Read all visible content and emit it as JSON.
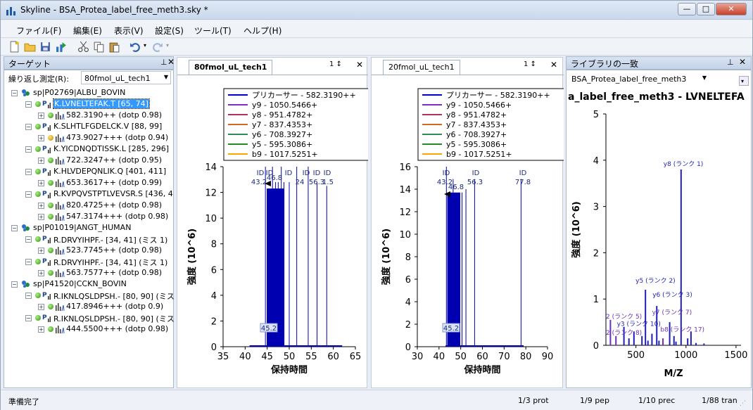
{
  "window": {
    "title": "Skyline - BSA_Protea_label_free_meth3.sky *"
  },
  "menu": [
    "ファイル(F)",
    "編集(E)",
    "表示(V)",
    "設定(S)",
    "ツール(T)",
    "ヘルプ(H)"
  ],
  "targets": {
    "title": "ターゲット",
    "replicate_label": "繰り返し測定(R):",
    "replicate_value": "80fmol_uL_tech1",
    "rows": [
      {
        "level": 0,
        "text": "sp|P02769|ALBU_BOVIN",
        "icon": "protein"
      },
      {
        "level": 1,
        "text": "K.LVNELTEFAK.T [65, 74]",
        "icon": "peptide",
        "selected": true
      },
      {
        "level": 2,
        "text": "582.3190++ (dotp 0.98)",
        "icon": "precursor",
        "dot": "g"
      },
      {
        "level": 1,
        "text": "K.SLHTLFGDELCK.V [88, 99]",
        "icon": "peptide"
      },
      {
        "level": 2,
        "text": "473.9027+++ (dotp 0.94)",
        "icon": "precursor",
        "dot": "y"
      },
      {
        "level": 1,
        "text": "K.YICDNQDTISSK.L [285, 296]",
        "icon": "peptide"
      },
      {
        "level": 2,
        "text": "722.3247++ (dotp 0.95)",
        "icon": "precursor",
        "dot": "g"
      },
      {
        "level": 1,
        "text": "K.HLVDEPQNLIK.Q [401, 411]",
        "icon": "peptide"
      },
      {
        "level": 2,
        "text": "653.3617++ (dotp 0.99)",
        "icon": "precursor",
        "dot": "g"
      },
      {
        "level": 1,
        "text": "R.KVPQVSTPTLVEVSR.S [436, 4",
        "icon": "peptide"
      },
      {
        "level": 2,
        "text": "820.4725++ (dotp 0.98)",
        "icon": "precursor",
        "dot": "g"
      },
      {
        "level": 2,
        "text": "547.3174+++ (dotp 0.98)",
        "icon": "precursor",
        "dot": "g"
      },
      {
        "level": 0,
        "text": "sp|P01019|ANGT_HUMAN",
        "icon": "protein"
      },
      {
        "level": 1,
        "text": "R.DRVYIHPF.- [34, 41] (ミス 1)",
        "icon": "peptide"
      },
      {
        "level": 2,
        "text": "523.7745++ (dotp 0.98)",
        "icon": "precursor",
        "dot": "g"
      },
      {
        "level": 1,
        "text": "R.DRVYIHPF.- [34, 41] (ミス 1)",
        "icon": "peptide"
      },
      {
        "level": 2,
        "text": "563.7577++ (dotp 0.98)",
        "icon": "precursor",
        "dot": "g"
      },
      {
        "level": 0,
        "text": "sp|P41520|CCKN_BOVIN",
        "icon": "protein"
      },
      {
        "level": 1,
        "text": "R.IKNLQSLDPSH.- [80, 90] (ミス",
        "icon": "peptide"
      },
      {
        "level": 2,
        "text": "417.8946+++ (dotp 0.9)",
        "icon": "precursor",
        "dot": "g"
      },
      {
        "level": 1,
        "text": "R.IKNLQSLDPSH.- [80, 90] (ミス",
        "icon": "peptide"
      },
      {
        "level": 2,
        "text": "444.5500+++ (dotp 0.98)",
        "icon": "precursor",
        "dot": "g"
      }
    ]
  },
  "legend": [
    {
      "label": "プリカーサー - 582.3190++",
      "color": "#0000cc"
    },
    {
      "label": "y9 - 1050.5466+",
      "color": "#7b2fbe"
    },
    {
      "label": "y8 - 951.4782+",
      "color": "#b03060"
    },
    {
      "label": "y7 - 837.4353+",
      "color": "#d2691e"
    },
    {
      "label": "y6 - 708.3927+",
      "color": "#2e8b57"
    },
    {
      "label": "y5 - 595.3086+",
      "color": "#228b22"
    },
    {
      "label": "b9 - 1017.5251+",
      "color": "#ffa500"
    }
  ],
  "chrom1": {
    "tab": "80fmol_uL_tech1",
    "xlabel": "保持時間",
    "ylabel": "強度 (10^6)",
    "xticks": [
      "35",
      "40",
      "45",
      "50",
      "55",
      "60",
      "65"
    ],
    "yticks": [
      "0",
      "2",
      "4",
      "6",
      "8",
      "10",
      "12",
      "14"
    ],
    "peak_labels": {
      "id": "ID",
      "a": "43.2",
      "b": "46.8",
      "c": "24",
      "d": "56.3",
      "e": "1.5",
      "f": "45.2"
    }
  },
  "chrom2": {
    "tab": "20fmol_uL_tech1",
    "xlabel": "保持時間",
    "ylabel": "強度 (10^6)",
    "xticks": [
      "30",
      "40",
      "50",
      "60",
      "70",
      "80",
      "90"
    ],
    "yticks": [
      "0",
      "2",
      "4",
      "6",
      "8",
      "10",
      "12",
      "14",
      "16"
    ],
    "peak_labels": {
      "id": "ID",
      "a": "43.2",
      "b": "46.8",
      "c": "56.3",
      "d": "77.8",
      "e": "45.2"
    }
  },
  "library": {
    "title": "ライブラリの一致",
    "library_name": "BSA_Protea_label_free_meth3",
    "spectrum_title": "a_label_free_meth3 - LVNELTEFA",
    "xlabel": "M/Z",
    "ylabel": "強度 (10^6)",
    "xticks": [
      "500",
      "1000",
      "1500"
    ],
    "yticks": [
      "0",
      "1",
      "2",
      "3",
      "4",
      "5"
    ],
    "ion_labels": {
      "y8": "y8 (ランク 1)",
      "y5": "y5 (ランク 2)",
      "y6": "y6 (ランク 3)",
      "b2": "2 (ランク 5)",
      "y7": "y7 (ランク 7)",
      "y3": "y3 (ランク 10)",
      "b8": "b8 (ランク 17)",
      "y2": "2 (ランク 8)"
    }
  },
  "status": {
    "ready": "準備完了",
    "prot": "1/3 prot",
    "pep": "1/9 pep",
    "prec": "1/10 prec",
    "tran": "1/88 tran"
  }
}
